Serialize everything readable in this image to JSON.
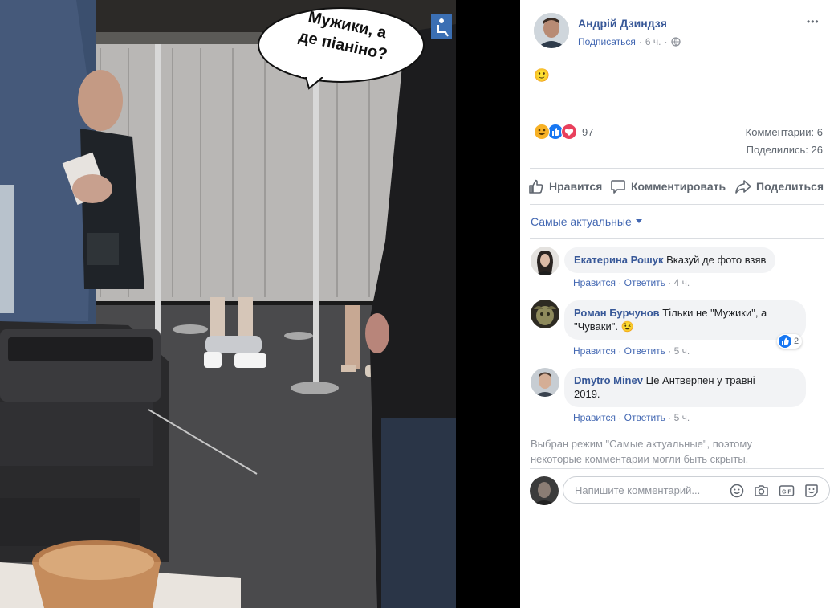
{
  "photo": {
    "speech_bubble": [
      "Мужики, а",
      "де піаніно?"
    ]
  },
  "post": {
    "author": "Андрій Дзиндзя",
    "subscribe": "Подписаться",
    "separator": "·",
    "time": "6 ч.",
    "more": "•••",
    "emoji_text": "🙂",
    "reactions_count": "97",
    "comments_count": "Комментарии: 6",
    "shares_count": "Поделились: 26"
  },
  "actions": {
    "like": "Нравится",
    "comment": "Комментировать",
    "share": "Поделиться"
  },
  "sort": {
    "label": "Самые актуальные"
  },
  "comments": [
    {
      "author": "Екатерина Рошук",
      "text": "Вказуй де фото взяв",
      "like": "Нравится",
      "reply": "Ответить",
      "time": "4 ч."
    },
    {
      "author": "Роман Бурчунов",
      "text_line1": "Тільки не \"Мужики\", а",
      "text_line2": "\"Чуваки\". 😉",
      "like": "Нравится",
      "reply": "Ответить",
      "time": "5 ч.",
      "reaction_count": "2"
    },
    {
      "author": "Dmytro Minev",
      "text_line1": "Це Антверпен у травні",
      "text_line2": "2019.",
      "like": "Нравится",
      "reply": "Ответить",
      "time": "5 ч."
    }
  ],
  "notice": {
    "line1": "Выбран режим \"Самые актуальные\", поэтому",
    "line2": "некоторые комментарии могли быть скрыты."
  },
  "composer": {
    "placeholder": "Напишите комментарий..."
  },
  "colors": {
    "link": "#385898",
    "accent": "#4267b2",
    "muted": "#90949c",
    "bubble_bg": "#f2f3f5"
  }
}
